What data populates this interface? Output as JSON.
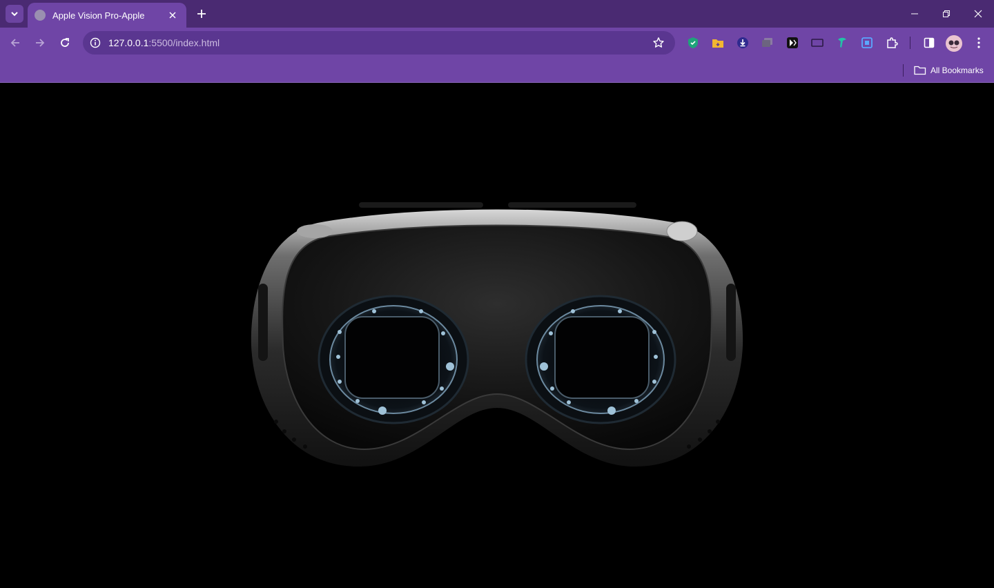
{
  "browser": {
    "tab_title": "Apple Vision Pro-Apple",
    "url_host": "127.0.0.1",
    "url_path": ":5500/index.html",
    "bookmarks_label": "All Bookmarks",
    "colors": {
      "tabstrip": "#4a2a72",
      "toolbar": "#6f45a6",
      "omnibox": "#5a3690"
    },
    "extensions": [
      "shield-extension-icon",
      "folder-extension-icon",
      "download-extension-icon",
      "tabs-extension-icon",
      "media-extension-icon",
      "screen-extension-icon",
      "pen-extension-icon",
      "capture-extension-icon",
      "puzzle-extension-icon"
    ]
  },
  "page": {
    "background": "#000000",
    "hero_image": "apple-vision-pro-headset-rear-view"
  }
}
